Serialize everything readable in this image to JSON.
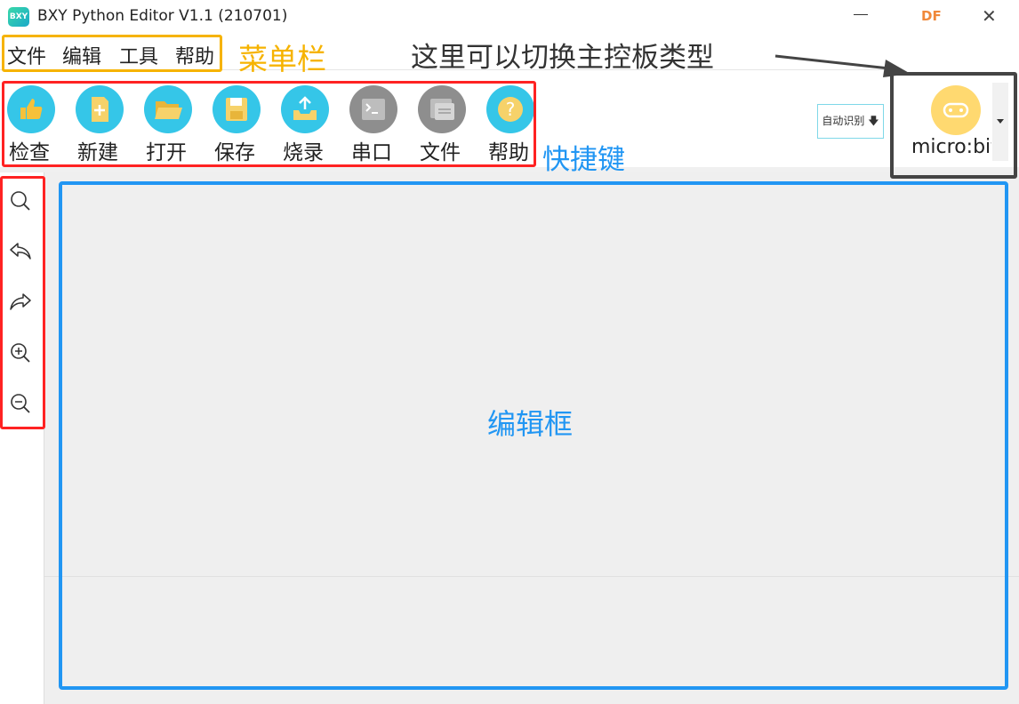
{
  "window": {
    "title": "BXY Python Editor V1.1 (210701)",
    "logo_text": "BXY",
    "brand_mark": "DF",
    "close_glyph": "✕"
  },
  "menu": {
    "items": [
      "文件",
      "编辑",
      "工具",
      "帮助"
    ]
  },
  "toolbar": {
    "items": [
      {
        "label": "检查",
        "icon": "thumbs-up-icon",
        "color": "#35c6e8"
      },
      {
        "label": "新建",
        "icon": "new-file-icon",
        "color": "#35c6e8"
      },
      {
        "label": "打开",
        "icon": "folder-open-icon",
        "color": "#35c6e8"
      },
      {
        "label": "保存",
        "icon": "save-icon",
        "color": "#35c6e8"
      },
      {
        "label": "烧录",
        "icon": "upload-icon",
        "color": "#35c6e8"
      },
      {
        "label": "串口",
        "icon": "terminal-icon",
        "color": "#8e8e8e"
      },
      {
        "label": "文件",
        "icon": "files-icon",
        "color": "#8e8e8e"
      },
      {
        "label": "帮助",
        "icon": "help-icon",
        "color": "#35c6e8"
      }
    ]
  },
  "auto_detect": {
    "label": "自动识别",
    "arrow": "🡇"
  },
  "board": {
    "name": "micro:bit"
  },
  "side_tools": [
    "search-icon",
    "undo-icon",
    "redo-icon",
    "zoom-in-icon",
    "zoom-out-icon"
  ],
  "annotations": {
    "menu_bar": "菜单栏",
    "board_switch": "这里可以切换主控板类型",
    "toolbar": "快捷键",
    "editor": "编辑框"
  },
  "colors": {
    "menu_annotation": "#f6b300",
    "toolbar_annotation": "#ff2222",
    "editor_annotation": "#2196f3",
    "board_annotation": "#444444",
    "tool_blue": "#35c6e8",
    "tool_gray": "#8e8e8e"
  }
}
